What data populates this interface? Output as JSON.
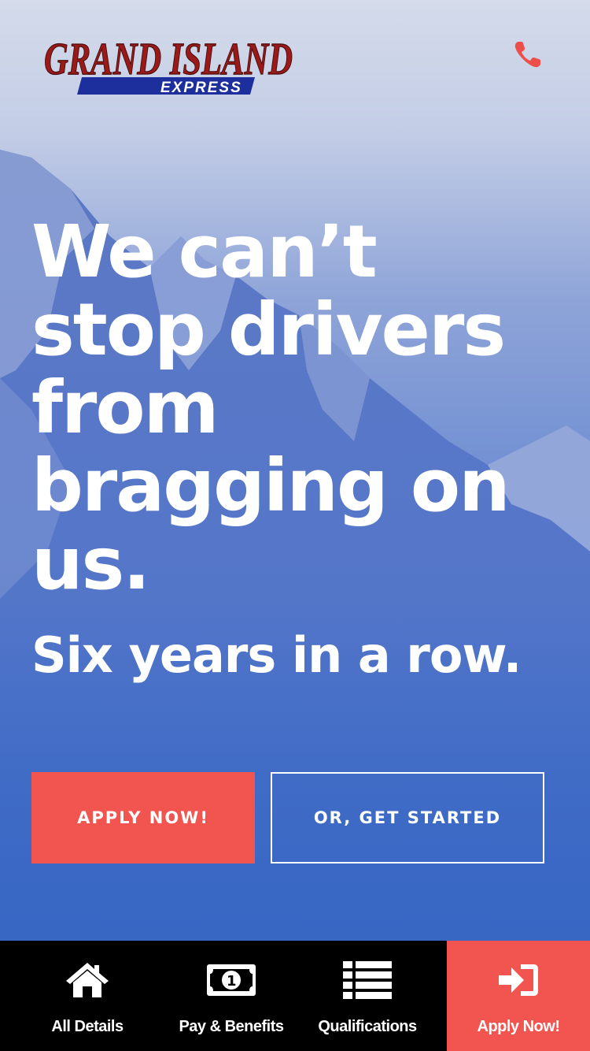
{
  "brand": {
    "logo_main": "GRAND ISLAND",
    "logo_sub": "EXPRESS",
    "colors": {
      "logo_red": "#9a1a1a",
      "logo_blue": "#1d2f9c",
      "accent": "#f25450"
    }
  },
  "header": {
    "phone_icon": "phone-icon"
  },
  "hero": {
    "headline": "We can’t stop drivers from bragging on us.",
    "subheadline": "Six years in a row.",
    "apply_button": "APPLY NOW!",
    "start_button": "OR, GET STARTED"
  },
  "tabbar": {
    "items": [
      {
        "label": "All Details",
        "icon": "home-icon"
      },
      {
        "label": "Pay & Benefits",
        "icon": "money-icon"
      },
      {
        "label": "Qualifications",
        "icon": "list-icon"
      },
      {
        "label": "Apply Now!",
        "icon": "sign-in-icon"
      }
    ]
  }
}
